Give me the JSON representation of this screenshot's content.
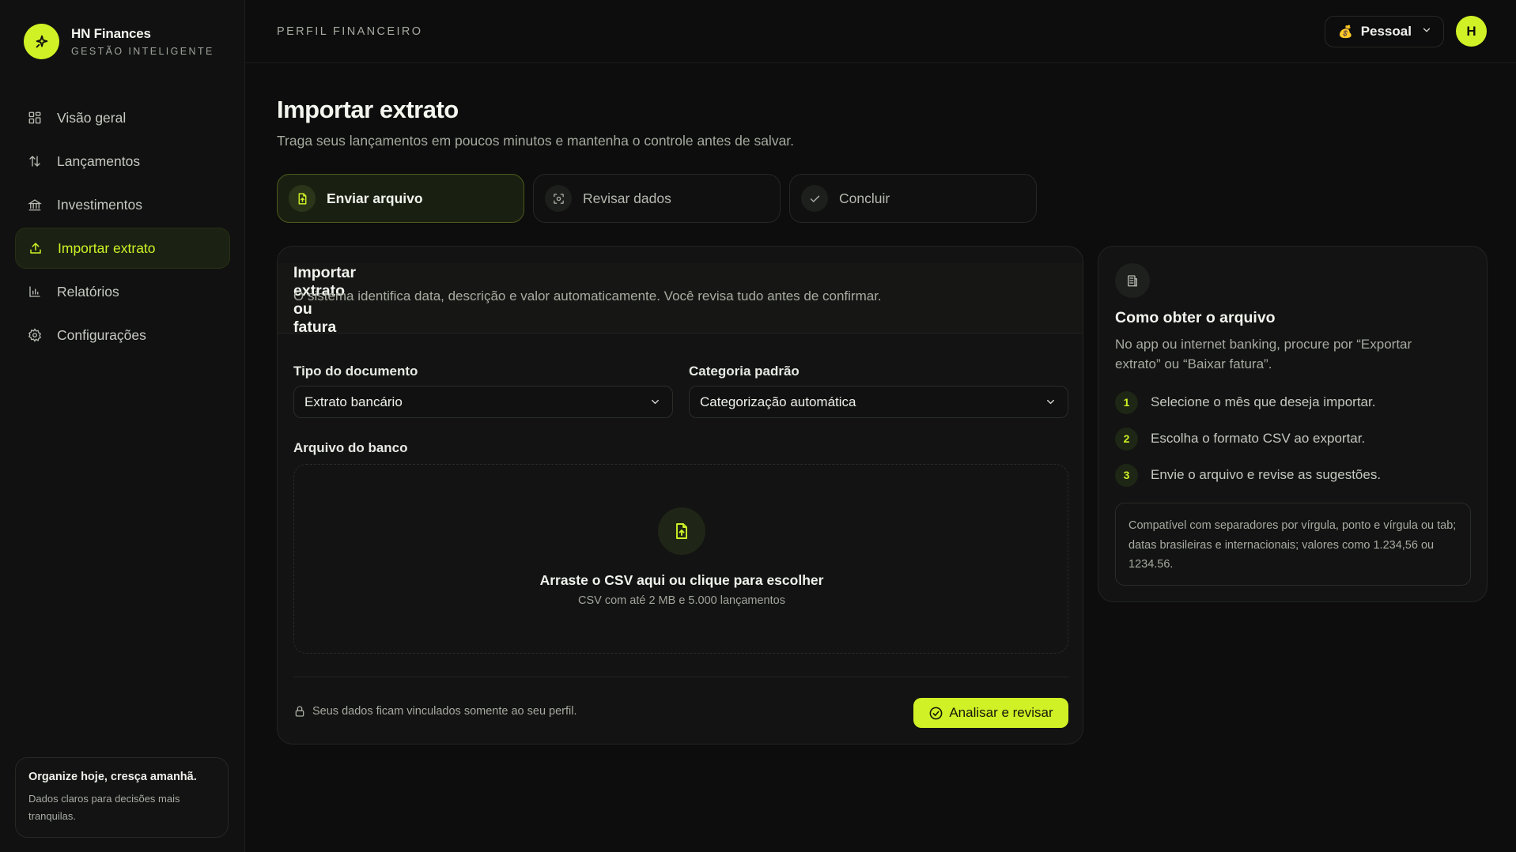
{
  "brand": {
    "name": "HN Finances",
    "tagline": "GESTÃO INTELIGENTE"
  },
  "sidebar": {
    "items": [
      {
        "label": "Visão geral",
        "icon": "grid-icon",
        "active": false
      },
      {
        "label": "Lançamentos",
        "icon": "arrows-updown-icon",
        "active": false
      },
      {
        "label": "Investimentos",
        "icon": "bank-icon",
        "active": false
      },
      {
        "label": "Importar extrato",
        "icon": "upload-icon",
        "active": true
      },
      {
        "label": "Relatórios",
        "icon": "bar-chart-icon",
        "active": false
      },
      {
        "label": "Configurações",
        "icon": "gear-icon",
        "active": false
      }
    ],
    "promo": {
      "title": "Organize hoje, cresça amanhã.",
      "text": "Dados claros para decisões mais tranquilas."
    }
  },
  "topbar": {
    "title": "PERFIL FINANCEIRO",
    "profile": {
      "emoji": "💰",
      "label": "Pessoal"
    },
    "avatar_initial": "H"
  },
  "main": {
    "title": "Importar extrato",
    "subtitle": "Traga seus lançamentos em poucos minutos e mantenha o controle antes de salvar.",
    "steps": [
      {
        "label": "Enviar arquivo",
        "icon": "file-upload-icon",
        "active": true
      },
      {
        "label": "Revisar dados",
        "icon": "scan-icon",
        "active": false
      },
      {
        "label": "Concluir",
        "icon": "check-icon",
        "active": false
      }
    ]
  },
  "import_card": {
    "title": "Importar extrato ou fatura",
    "description": "O sistema identifica data, descrição e valor automaticamente. Você revisa tudo antes de confirmar.",
    "doc_type": {
      "label": "Tipo do documento",
      "value": "Extrato bancário"
    },
    "category": {
      "label": "Categoria padrão",
      "value": "Categorização automática"
    },
    "file": {
      "label": "Arquivo do banco",
      "drop_title": "Arraste o CSV aqui ou clique para escolher",
      "drop_sub": "CSV com até 2 MB e 5.000 lançamentos"
    },
    "privacy": "Seus dados ficam vinculados somente ao seu perfil.",
    "analyze_label": "Analisar e revisar"
  },
  "help_card": {
    "title": "Como obter o arquivo",
    "description": "No app ou internet banking, procure por “Exportar extrato” ou “Baixar fatura”.",
    "steps": [
      {
        "num": "1",
        "text": "Selecione o mês que deseja importar."
      },
      {
        "num": "2",
        "text": "Escolha o formato CSV ao exportar."
      },
      {
        "num": "3",
        "text": "Envie o arquivo e revise as sugestões."
      }
    ],
    "note": "Compatível com separadores por vírgula, ponto e vírgula ou tab; datas brasileiras e internacionais; valores como 1.234,56 ou 1234.56."
  },
  "colors": {
    "accent": "#cff126",
    "background": "#0c0d0c",
    "panel": "#121312"
  }
}
